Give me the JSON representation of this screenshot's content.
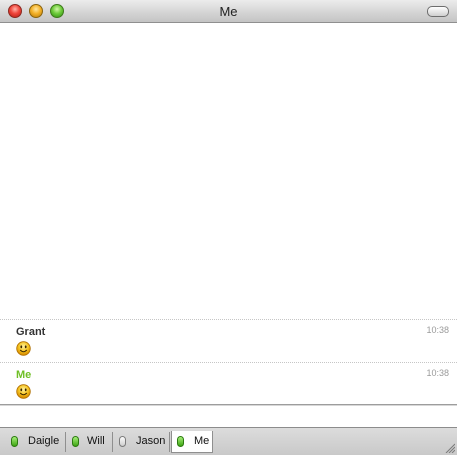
{
  "window": {
    "title": "Me"
  },
  "messages": [
    {
      "sender": "Grant",
      "time": "10:38",
      "content_icon": "smiley-icon"
    },
    {
      "sender": "Me",
      "time": "10:38",
      "content_icon": "smiley-icon"
    }
  ],
  "tabs": [
    {
      "label": "Daigle",
      "status": "online",
      "status_color": "#4bbf1f"
    },
    {
      "label": "Will",
      "status": "online",
      "status_color": "#4bbf1f"
    },
    {
      "label": "Jason",
      "status": "idle",
      "status_color": "#d8d8d8"
    },
    {
      "label": "Me",
      "status": "online",
      "status_color": "#4bbf1f",
      "active": true
    }
  ],
  "colors": {
    "my_name": "#6fbf26",
    "title_bar": "#d3d3d3"
  }
}
